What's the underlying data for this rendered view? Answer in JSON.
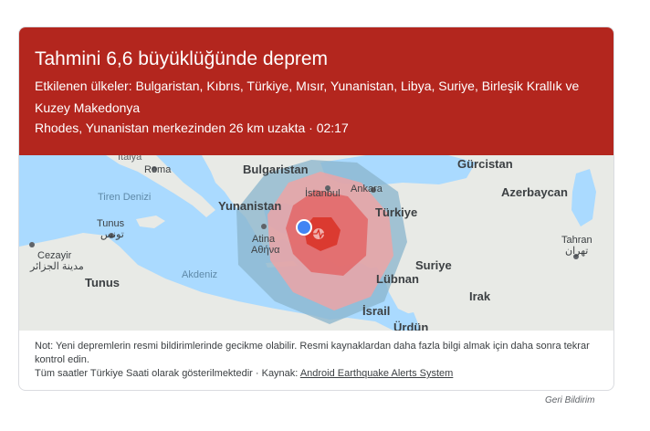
{
  "alert": {
    "title": "Tahmini 6,6 büyüklüğünde deprem",
    "affected_countries": "Etkilenen ülkeler: Bulgaristan, Kıbrıs, Türkiye, Mısır, Yunanistan, Libya, Suriye, Birleşik Krallık ve Kuzey Makedonya",
    "location_time": "Rhodes, Yunanistan merkezinden 26 km uzakta · 02:17"
  },
  "map": {
    "labels": {
      "italya": "İtalya",
      "roma": "Roma",
      "bulgaristan": "Bulgaristan",
      "gurcistan": "Gürcistan",
      "istanbul": "İstanbul",
      "ankara": "Ankara",
      "azerbaycan": "Azerbaycan",
      "tiren": "Tiren Denizi",
      "yunanistan": "Yunanistan",
      "turkiye": "Türkiye",
      "tunus_city": "Tunus",
      "tunus_ar": "تونس",
      "atina": "Atina",
      "atina_gr": "Αθήνα",
      "tahran": "Tahran",
      "tahran_fa": "تهران",
      "cezayir": "Cezayir",
      "cezayir_ar": "مدينة الجزائر",
      "akdeniz": "Akdeniz",
      "suriye": "Suriye",
      "tunus_country": "Tunus",
      "lubnan": "Lübnan",
      "irak": "Irak",
      "israil": "İsrail",
      "urdun": "Ürdün"
    },
    "colors": {
      "sea": "#aadaff",
      "land": "#e8eae6",
      "intensity_outer": "#8ab4cc",
      "intensity_mid": "#f1a3a3",
      "intensity_inner": "#e35d5d",
      "intensity_core": "#d93025",
      "user_dot": "#4285f4"
    }
  },
  "footer": {
    "note": "Not: Yeni depremlerin resmi bildirimlerinde gecikme olabilir. Resmi kaynaklardan daha fazla bilgi almak için daha sonra tekrar kontrol edin.",
    "timezone_note": "Tüm saatler Türkiye Saati olarak gösterilmektedir · Kaynak:",
    "source_link": "Android Earthquake Alerts System"
  },
  "feedback_link": "Geri Bildirim"
}
